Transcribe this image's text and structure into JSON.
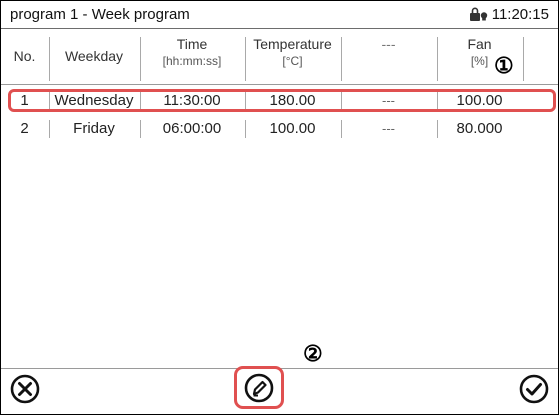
{
  "window": {
    "title": "program 1 - Week program",
    "time": "11:20:15"
  },
  "table": {
    "columns": [
      {
        "label": "No.",
        "unit": ""
      },
      {
        "label": "Weekday",
        "unit": ""
      },
      {
        "label": "Time",
        "unit": "[hh:mm:ss]"
      },
      {
        "label": "Temperature",
        "unit": "[°C]"
      },
      {
        "label": "---",
        "unit": ""
      },
      {
        "label": "Fan",
        "unit": "[%]"
      }
    ],
    "rows": [
      {
        "no": "1",
        "weekday": "Wednesday",
        "time": "11:30:00",
        "temperature": "180.00",
        "extra": "---",
        "fan": "100.00"
      },
      {
        "no": "2",
        "weekday": "Friday",
        "time": "06:00:00",
        "temperature": "100.00",
        "extra": "---",
        "fan": "80.000"
      }
    ]
  },
  "annotations": {
    "marker1": "①",
    "marker2": "②"
  },
  "toolbar": {
    "cancel_icon": "close-circle-icon",
    "edit_icon": "pencil-edit-icon",
    "confirm_icon": "check-circle-icon"
  },
  "colors": {
    "highlight": "#e05050"
  }
}
